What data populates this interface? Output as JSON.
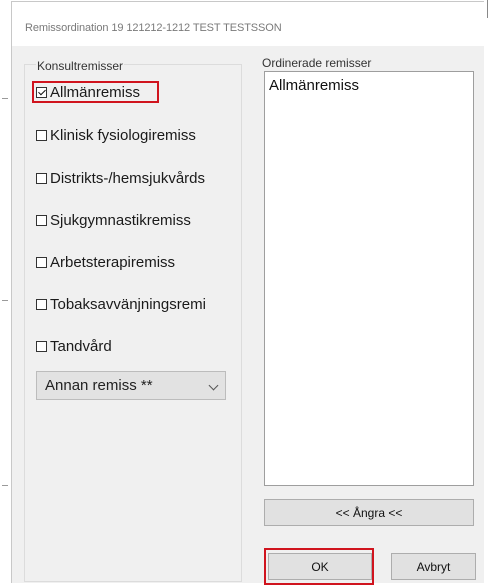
{
  "window": {
    "title": "Remissordination 19 121212-1212 TEST TESTSSON"
  },
  "consult_group": {
    "label": "Konsultremisser",
    "items": [
      {
        "label": "Allmänremiss",
        "checked": true
      },
      {
        "label": "Klinisk fysiologiremiss",
        "checked": false
      },
      {
        "label": "Distrikts-/hemsjukvårds",
        "checked": false
      },
      {
        "label": "Sjukgymnastikremiss",
        "checked": false
      },
      {
        "label": "Arbetsterapiremiss",
        "checked": false
      },
      {
        "label": "Tobaksavvänjningsremi",
        "checked": false
      },
      {
        "label": "Tandvård",
        "checked": false
      }
    ],
    "other_dropdown": {
      "selected": "Annan remiss **"
    }
  },
  "ordered": {
    "label": "Ordinerade remisser",
    "items": [
      "Allmänremiss"
    ]
  },
  "buttons": {
    "undo": "<< Ångra <<",
    "ok": "OK",
    "cancel": "Avbryt"
  },
  "colors": {
    "highlight": "#d0141e",
    "dialog_bg": "#f0f0f0"
  }
}
